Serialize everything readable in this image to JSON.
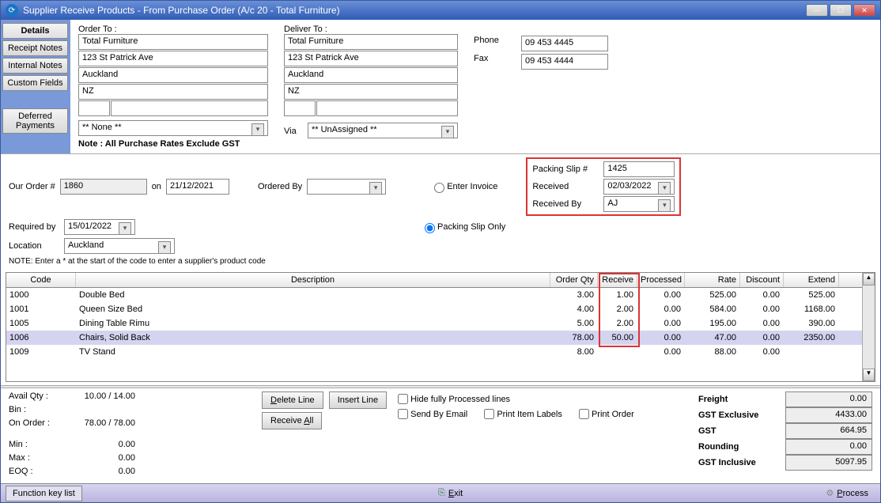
{
  "window": {
    "title": "Supplier Receive Products - From Purchase Order (A/c 20 - Total Furniture)"
  },
  "sidebar": {
    "details": "Details",
    "receipt_notes": "Receipt Notes",
    "internal_notes": "Internal Notes",
    "custom_fields": "Custom Fields",
    "deferred_payments": "Deferred\nPayments"
  },
  "orderto": {
    "label": "Order To :",
    "name": "Total Furniture",
    "street": "123 St Patrick Ave",
    "city": "Auckland",
    "country": "NZ",
    "contact": "** None **"
  },
  "deliverto": {
    "label": "Deliver To :",
    "name": "Total Furniture",
    "street": "123 St Patrick Ave",
    "city": "Auckland",
    "country": "NZ"
  },
  "phone": {
    "label": "Phone",
    "value": "09 453 4445"
  },
  "fax": {
    "label": "Fax",
    "value": "09 453 4444"
  },
  "note": "Note : All Purchase Rates Exclude GST",
  "via": {
    "label": "Via",
    "value": "** UnAssigned **"
  },
  "order": {
    "our_order_label": "Our Order #",
    "our_order": "1860",
    "on_label": "on",
    "on": "21/12/2021",
    "ordered_by_label": "Ordered By",
    "ordered_by": "",
    "required_label": "Required by",
    "required": "15/01/2022",
    "location_label": "Location",
    "location": "Auckland",
    "code_note": "NOTE: Enter a * at the start of the code to enter a supplier's product code"
  },
  "radios": {
    "enter_invoice": "Enter Invoice",
    "packing_slip_only": "Packing Slip Only"
  },
  "packing": {
    "slip_label": "Packing Slip #",
    "slip": "1425",
    "received_label": "Received",
    "received": "02/03/2022",
    "received_by_label": "Received By",
    "received_by": "AJ"
  },
  "grid": {
    "headers": {
      "code": "Code",
      "desc": "Description",
      "orderqty": "Order Qty",
      "receive": "Receive",
      "processed": "Processed",
      "rate": "Rate",
      "discount": "Discount",
      "extend": "Extend"
    },
    "rows": [
      {
        "code": "1000",
        "desc": "Double Bed",
        "orderqty": "3.00",
        "receive": "1.00",
        "processed": "0.00",
        "rate": "525.00",
        "discount": "0.00",
        "extend": "525.00"
      },
      {
        "code": "1001",
        "desc": "Queen Size Bed",
        "orderqty": "4.00",
        "receive": "2.00",
        "processed": "0.00",
        "rate": "584.00",
        "discount": "0.00",
        "extend": "1168.00"
      },
      {
        "code": "1005",
        "desc": "Dining Table Rimu",
        "orderqty": "5.00",
        "receive": "2.00",
        "processed": "0.00",
        "rate": "195.00",
        "discount": "0.00",
        "extend": "390.00"
      },
      {
        "code": "1006",
        "desc": "Chairs, Solid Back",
        "orderqty": "78.00",
        "receive": "50.00",
        "processed": "0.00",
        "rate": "47.00",
        "discount": "0.00",
        "extend": "2350.00"
      },
      {
        "code": "1009",
        "desc": "TV Stand",
        "orderqty": "8.00",
        "receive": "",
        "processed": "0.00",
        "rate": "88.00",
        "discount": "0.00",
        "extend": ""
      }
    ]
  },
  "stock": {
    "avail_label": "Avail Qty :",
    "avail": "10.00 / 14.00",
    "bin_label": "Bin :",
    "bin": "",
    "onorder_label": "On Order :",
    "onorder": "78.00 / 78.00",
    "min_label": "Min :",
    "min": "0.00",
    "max_label": "Max :",
    "max": "0.00",
    "eoq_label": "EOQ :",
    "eoq": "0.00"
  },
  "actions": {
    "delete": "Delete Line",
    "insert": "Insert Line",
    "receive_all": "Receive All"
  },
  "checks": {
    "hide": "Hide fully Processed lines",
    "email": "Send By Email",
    "labels": "Print Item Labels",
    "order": "Print Order"
  },
  "totals": {
    "freight_label": "Freight",
    "freight": "0.00",
    "gstex_label": "GST Exclusive",
    "gstex": "4433.00",
    "gst_label": "GST",
    "gst": "664.95",
    "round_label": "Rounding",
    "round": "0.00",
    "gstin_label": "GST Inclusive",
    "gstin": "5097.95"
  },
  "bottombar": {
    "fkeys": "Function key list",
    "exit": "Exit",
    "process": "Process"
  }
}
